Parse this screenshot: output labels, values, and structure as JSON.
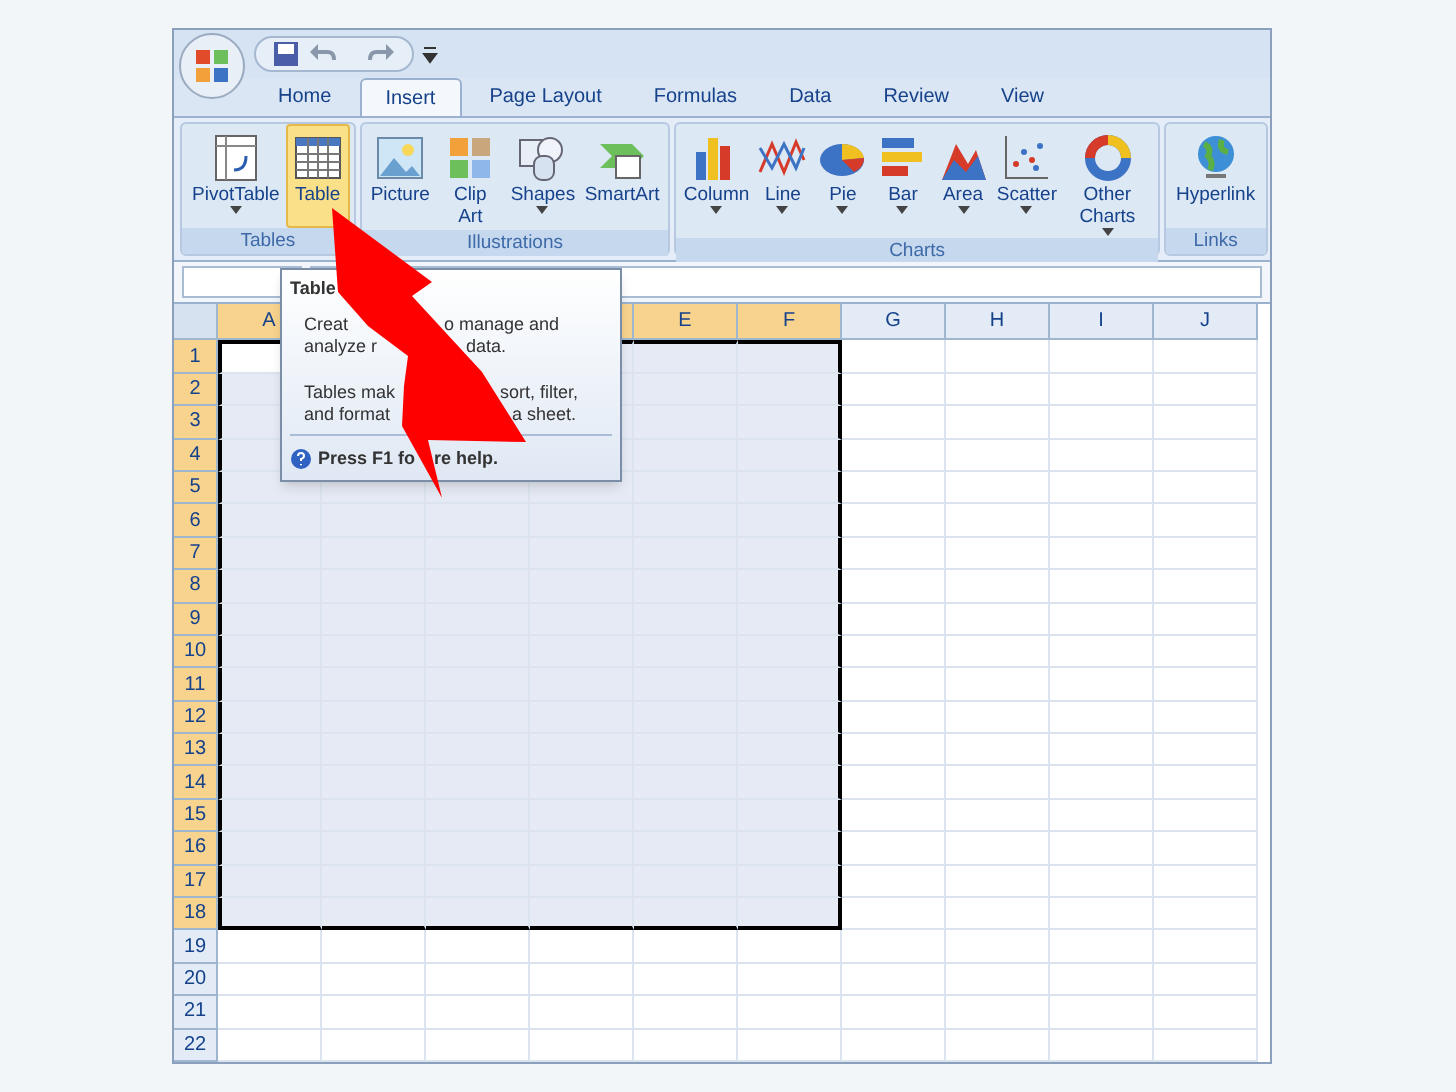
{
  "tabs": [
    {
      "label": "Home",
      "selected": false
    },
    {
      "label": "Insert",
      "selected": true
    },
    {
      "label": "Page Layout",
      "selected": false
    },
    {
      "label": "Formulas",
      "selected": false
    },
    {
      "label": "Data",
      "selected": false
    },
    {
      "label": "Review",
      "selected": false
    },
    {
      "label": "View",
      "selected": false
    }
  ],
  "groups": [
    {
      "label": "Tables",
      "buttons": [
        {
          "label": "PivotTable",
          "dropdown": true,
          "selected": false
        },
        {
          "label": "Table",
          "dropdown": false,
          "selected": true
        }
      ]
    },
    {
      "label": "Illustrations",
      "buttons": [
        {
          "label": "Picture",
          "dropdown": false,
          "selected": false
        },
        {
          "label": "Clip Art",
          "dropdown": false,
          "selected": false
        },
        {
          "label": "Shapes",
          "dropdown": true,
          "selected": false
        },
        {
          "label": "SmartArt",
          "dropdown": false,
          "selected": false
        }
      ]
    },
    {
      "label": "Charts",
      "buttons": [
        {
          "label": "Column",
          "dropdown": true,
          "selected": false
        },
        {
          "label": "Line",
          "dropdown": true,
          "selected": false
        },
        {
          "label": "Pie",
          "dropdown": true,
          "selected": false
        },
        {
          "label": "Bar",
          "dropdown": true,
          "selected": false
        },
        {
          "label": "Area",
          "dropdown": true,
          "selected": false
        },
        {
          "label": "Scatter",
          "dropdown": true,
          "selected": false
        },
        {
          "label": "Other Charts",
          "dropdown": true,
          "selected": false
        }
      ]
    },
    {
      "label": "Links",
      "buttons": [
        {
          "label": "Hyperlink",
          "dropdown": false,
          "selected": false
        }
      ]
    }
  ],
  "tooltip": {
    "title": "Table",
    "lines": [
      [
        "Creat",
        "o manage and"
      ],
      [
        "analyze r",
        "data."
      ],
      [
        "Tables mak",
        "sort, filter,"
      ],
      [
        "and format",
        "a sheet."
      ]
    ],
    "help": [
      "Press F1 fo",
      "re help."
    ]
  },
  "columns": [
    {
      "label": "A",
      "selected": true
    },
    {
      "selected": true
    },
    {
      "selected": true
    },
    {
      "selected": true
    },
    {
      "label": "E",
      "selected": true
    },
    {
      "label": "F",
      "selected": true
    },
    {
      "label": "G",
      "selected": false
    },
    {
      "label": "H",
      "selected": false
    },
    {
      "label": "I",
      "selected": false
    },
    {
      "label": "J",
      "selected": false
    }
  ],
  "rows": [
    {
      "label": "1",
      "selected": true
    },
    {
      "label": "2",
      "selected": true
    },
    {
      "label": "3",
      "selected": true
    },
    {
      "label": "4",
      "selected": true
    },
    {
      "label": "5",
      "selected": true
    },
    {
      "label": "6",
      "selected": true
    },
    {
      "label": "7",
      "selected": true
    },
    {
      "label": "8",
      "selected": true
    },
    {
      "label": "9",
      "selected": true
    },
    {
      "label": "10",
      "selected": true
    },
    {
      "label": "11",
      "selected": true
    },
    {
      "label": "12",
      "selected": true
    },
    {
      "label": "13",
      "selected": true
    },
    {
      "label": "14",
      "selected": true
    },
    {
      "label": "15",
      "selected": true
    },
    {
      "label": "16",
      "selected": true
    },
    {
      "label": "17",
      "selected": true
    },
    {
      "label": "18",
      "selected": true
    },
    {
      "label": "19",
      "selected": false
    },
    {
      "label": "20",
      "selected": false
    },
    {
      "label": "21",
      "selected": false
    },
    {
      "label": "22",
      "selected": false
    }
  ]
}
